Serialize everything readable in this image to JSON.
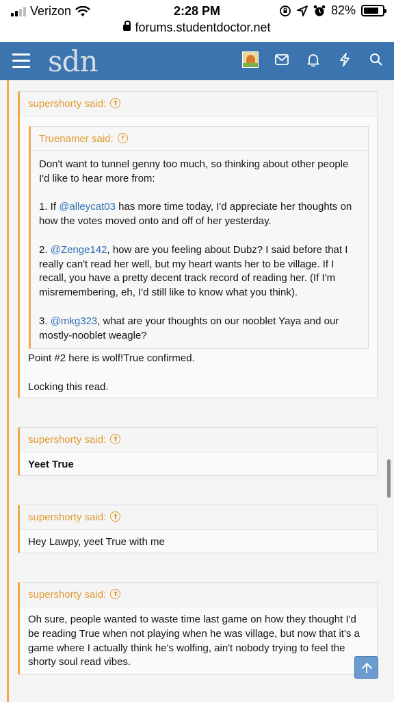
{
  "status_bar": {
    "carrier": "Verizon",
    "time": "2:28 PM",
    "battery": "82%"
  },
  "browser": {
    "url": "forums.studentdoctor.net"
  },
  "navbar": {
    "logo": "sdn",
    "icons": [
      "menu-icon",
      "avatar",
      "mail-icon",
      "bell-icon",
      "bolt-icon",
      "search-icon"
    ]
  },
  "posts": [
    {
      "author": "supershorty said:",
      "quote": {
        "author": "Truenamer said:",
        "p1": "Don't want to tunnel genny too much, so thinking about other people I'd like to hear more from:",
        "p2_pre": "1. If ",
        "p2_mention": "@alleycat03",
        "p2_post": " has more time today, I'd appreciate her thoughts on how the votes moved onto and off of her yesterday.",
        "p3_pre": "2. ",
        "p3_mention": "@Zenge142",
        "p3_post": ", how are you feeling about Dubz? I said before that I really can't read her well, but my heart wants her to be village. If I recall, you have a pretty decent track record of reading her. (If I'm misremembering, eh, I'd still like to know what you think).",
        "p4_pre": "3. ",
        "p4_mention": "@mkg323",
        "p4_post": ", what are your thoughts on our nooblet Yaya and our mostly-nooblet weagle?"
      },
      "line1": "Point #2 here is wolf!True confirmed.",
      "line2": "Locking this read."
    },
    {
      "author": "supershorty said:",
      "text": "Yeet True"
    },
    {
      "author": "supershorty said:",
      "text": "Hey Lawpy, yeet True with me"
    },
    {
      "author": "supershorty said:",
      "text": "Oh sure, people wanted to waste time last game on how they thought I'd be reading True when not playing when he was village, but now that it's a game where I actually think he's wolfing, ain't nobody trying to feel the shorty soul read vibes."
    }
  ]
}
